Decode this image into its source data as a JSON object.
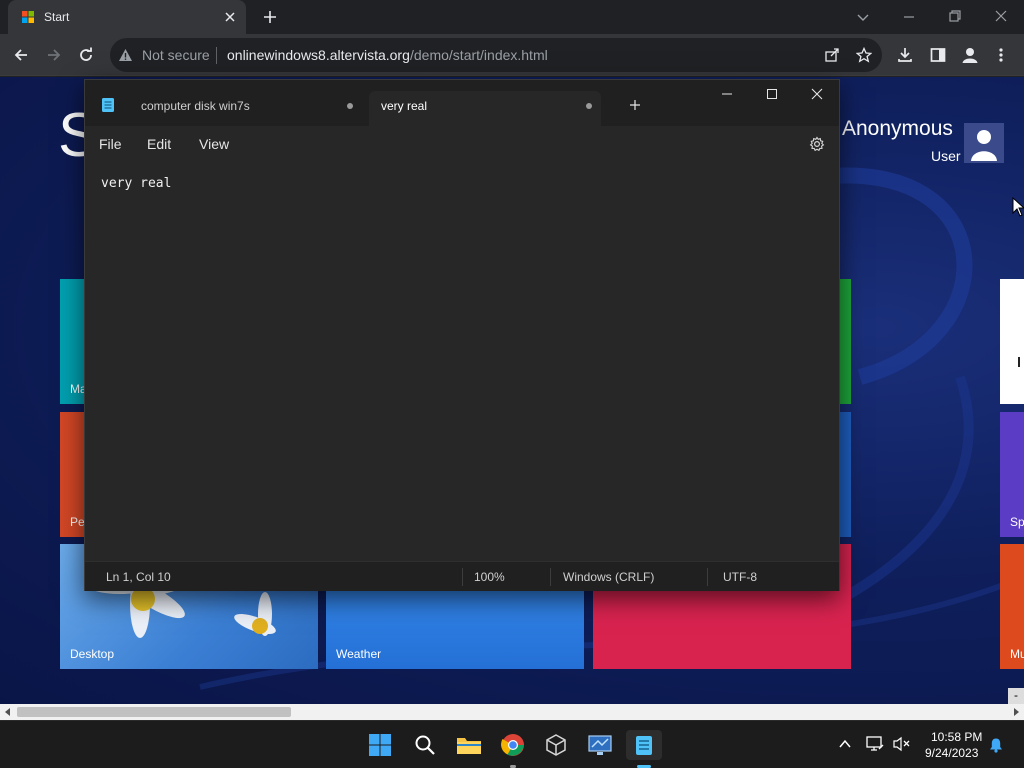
{
  "browser": {
    "tab_title": "Start",
    "security_label": "Not secure",
    "url_host": "onlinewindows8.altervista.org",
    "url_path": "/demo/start/index.html"
  },
  "start_page": {
    "heading_initial": "S",
    "user_name": "Anonymous",
    "user_role": "User",
    "tiles": [
      {
        "label": "Ma",
        "color": "#00a0b0"
      },
      {
        "label": "Pe",
        "color": "#d24726"
      },
      {
        "label": "Desktop",
        "color": "#4a90e2"
      },
      {
        "label": "Weather",
        "color": "#2d7de0"
      },
      {
        "label": "",
        "color": "#d8234f"
      },
      {
        "label": "Sp",
        "color": "#5b3cc4"
      },
      {
        "label": "Mu",
        "color": "#dc4a1e"
      }
    ]
  },
  "notepad": {
    "tabs": [
      {
        "label": "computer disk win7s",
        "active": false
      },
      {
        "label": "very real",
        "active": true
      }
    ],
    "menu": [
      "File",
      "Edit",
      "View"
    ],
    "content": "very real",
    "status": {
      "position": "Ln 1, Col 10",
      "zoom": "100%",
      "line_ending": "Windows (CRLF)",
      "encoding": "UTF-8"
    }
  },
  "taskbar": {
    "time": "10:58 PM",
    "date": "9/24/2023"
  }
}
